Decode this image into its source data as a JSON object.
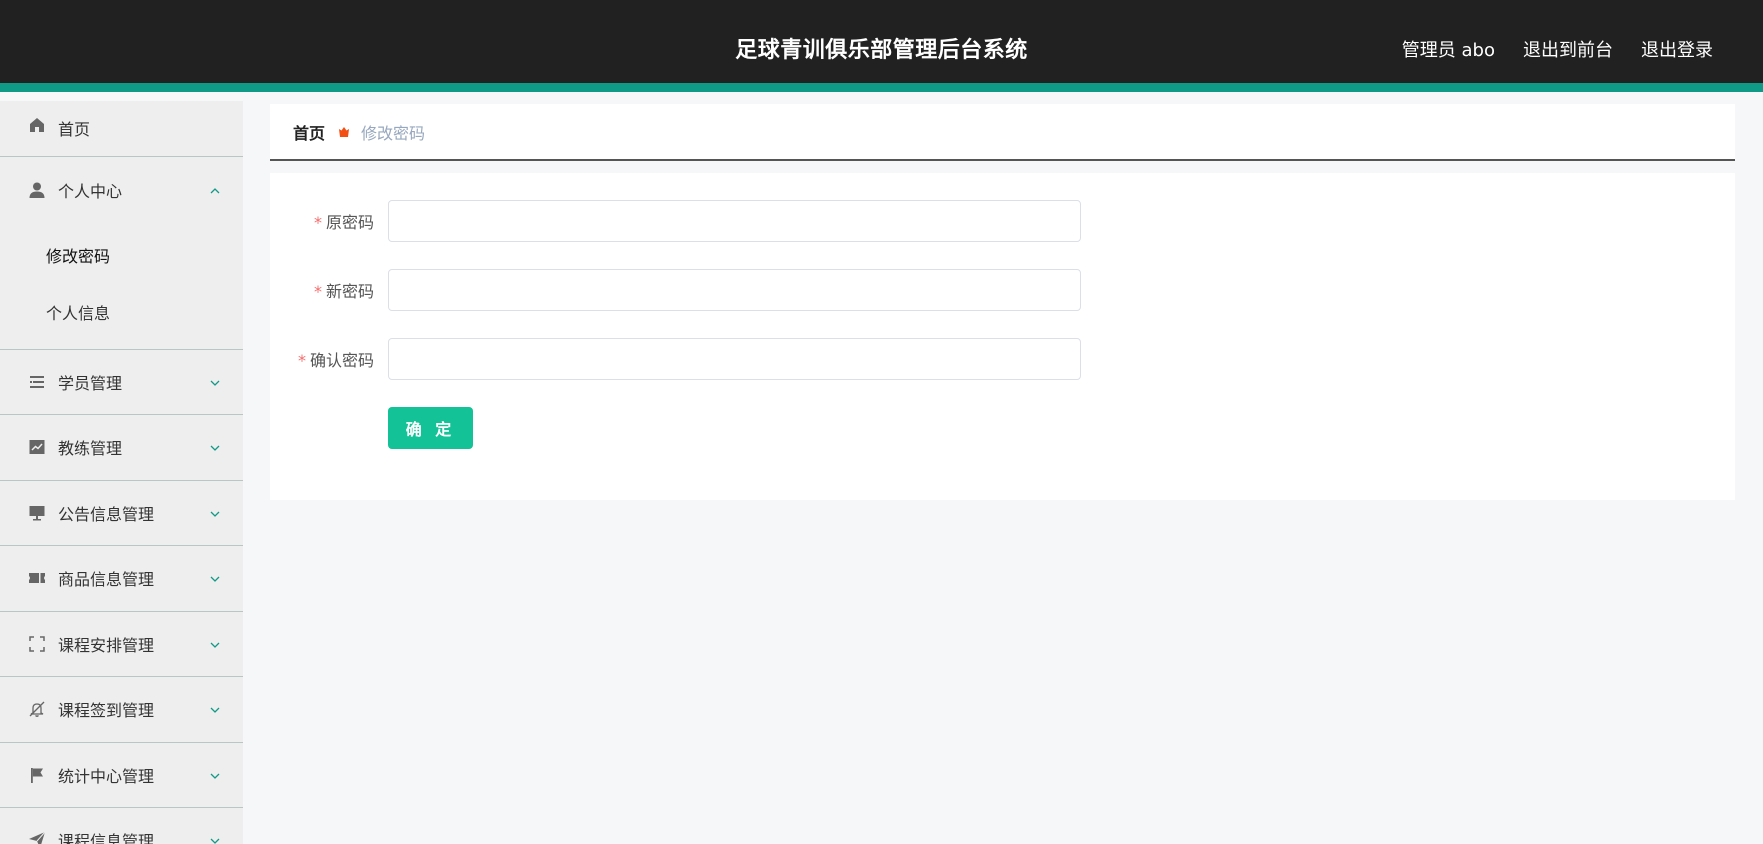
{
  "header": {
    "title": "足球青训俱乐部管理后台系统",
    "user": "管理员 abo",
    "to_front": "退出到前台",
    "logout": "退出登录"
  },
  "sidebar": {
    "home": "首页",
    "personal_center": "个人中心",
    "change_password": "修改密码",
    "personal_info": "个人信息",
    "items": [
      {
        "label": "学员管理",
        "icon": "list-icon"
      },
      {
        "label": "教练管理",
        "icon": "chart-icon"
      },
      {
        "label": "公告信息管理",
        "icon": "monitor-icon"
      },
      {
        "label": "商品信息管理",
        "icon": "ticket-icon"
      },
      {
        "label": "课程安排管理",
        "icon": "fullscreen-icon"
      },
      {
        "label": "课程签到管理",
        "icon": "bell-off-icon"
      },
      {
        "label": "统计中心管理",
        "icon": "flag-icon"
      },
      {
        "label": "课程信息管理",
        "icon": "send-icon"
      }
    ]
  },
  "breadcrumb": {
    "home": "首页",
    "current": "修改密码"
  },
  "form": {
    "old_password_label": "原密码",
    "new_password_label": "新密码",
    "confirm_password_label": "确认密码",
    "required_mark": "*",
    "submit": "确 定"
  },
  "colors": {
    "header_bg": "#212121",
    "accent": "#0f9a87",
    "button": "#13c296",
    "breadcrumb_icon": "#f24f14"
  }
}
